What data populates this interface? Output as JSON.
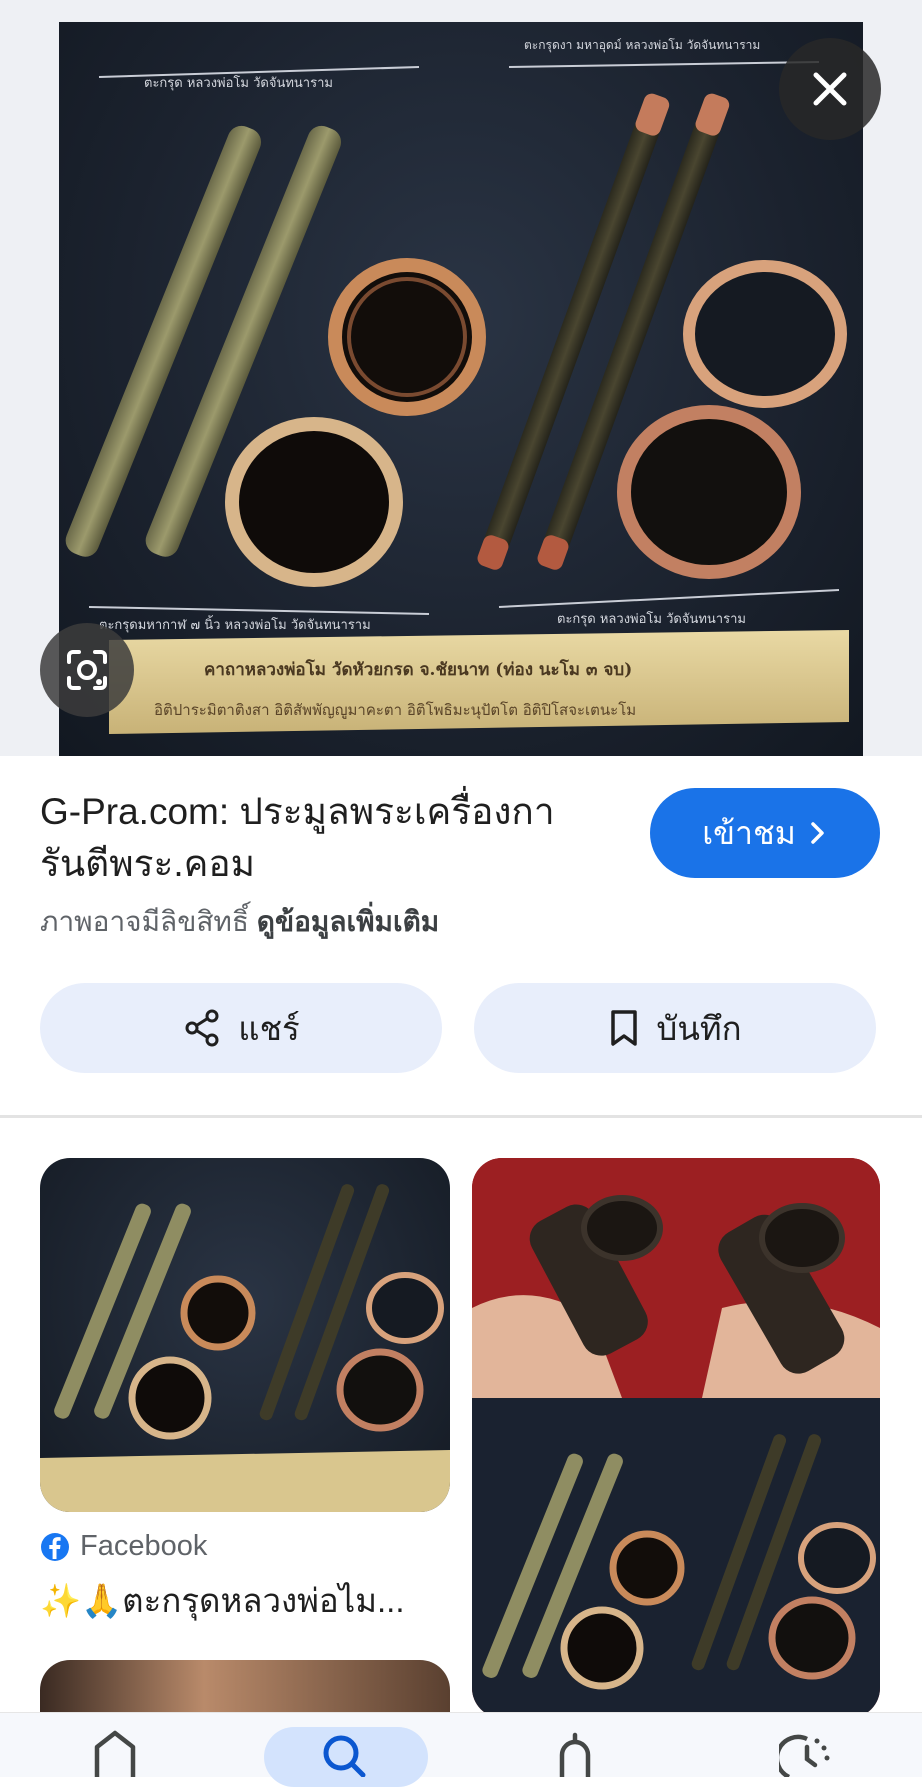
{
  "viewer": {
    "close_label": "close",
    "lens_label": "lens"
  },
  "hero_image": {
    "text_top_left": "ตะกรุด หลวงพ่อโม วัดจันทนาราม",
    "text_top_right": "ตะกรุดงา มหาอุดม์ หลวงพ่อโม วัดจันทนาราม",
    "text_bottom_left": "ตะกรุดมหากาฬ ๗ นิ้ว หลวงพ่อโม วัดจันทนาราม",
    "text_bottom_right": "ตะกรุด หลวงพ่อโม วัดจันทนาราม",
    "banner_line1": "คาถาหลวงพ่อโม วัดหัวยกรด จ.ชัยนาท (ท่อง นะโม ๓ จบ)",
    "banner_line2": "อิติปาระมิตาติงสา อิติสัพพัญญูมาคะตา อิติโพธิมะนุปัตโต อิติปิโสจะเตนะโม"
  },
  "result": {
    "title_site": "G-Pra.com:",
    "title_rest": " ประมูลพระเครื่องกา",
    "title_line2": "รันตีพระ.คอม",
    "visit_label": "เข้าชม",
    "copyright_text": "ภาพอาจมีลิขสิทธิ์",
    "more_info_label": "ดูข้อมูลเพิ่มเติม"
  },
  "actions": {
    "share_label": "แชร์",
    "save_label": "บันทึก"
  },
  "related": {
    "item1_source": "Facebook",
    "item1_caption": "✨🙏ตะกรุดหลวงพ่อไม..."
  },
  "colors": {
    "accent": "#1a73e8",
    "pill_bg": "#e8eefb",
    "facebook": "#1877f2"
  }
}
